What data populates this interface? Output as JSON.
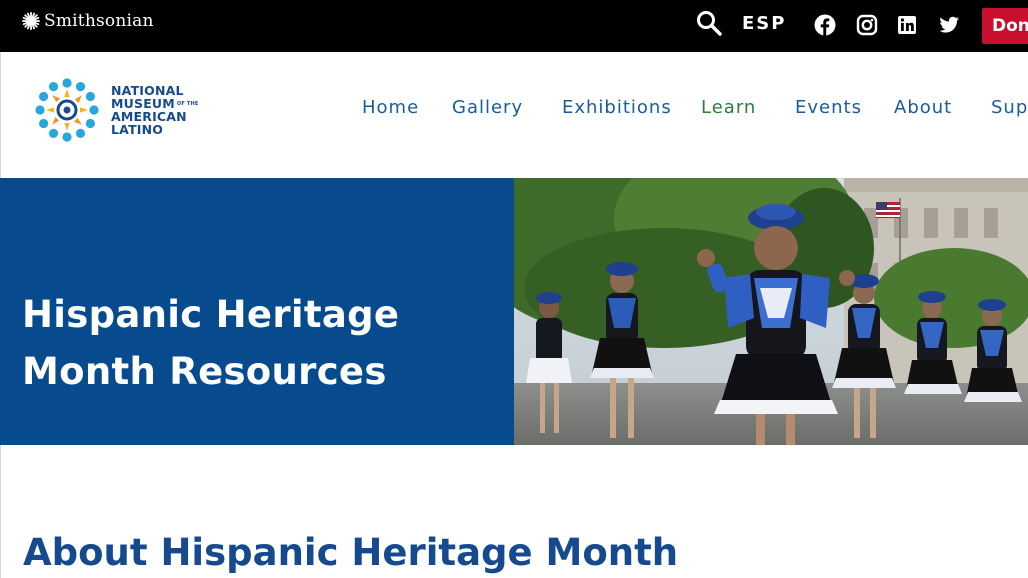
{
  "topbar": {
    "brand_label": "Smithsonian",
    "search_icon": "search-icon",
    "language_label": "ESP",
    "social": [
      {
        "name": "facebook-icon"
      },
      {
        "name": "instagram-icon"
      },
      {
        "name": "linkedin-icon"
      },
      {
        "name": "twitter-icon"
      }
    ],
    "donate_label": "Don"
  },
  "header": {
    "logo_lines": [
      "NATIONAL",
      "MUSEUM",
      "AMERICAN",
      "LATINO"
    ],
    "logo_small": "OF THE",
    "nav": [
      {
        "label": "Home"
      },
      {
        "label": "Gallery"
      },
      {
        "label": "Exhibitions"
      },
      {
        "label": "Learn"
      },
      {
        "label": "Events"
      },
      {
        "label": "About"
      },
      {
        "label": "Sup"
      }
    ]
  },
  "hero": {
    "title_line1": "Hispanic Heritage",
    "title_line2": "Month Resources"
  },
  "content": {
    "heading": "About Hispanic Heritage Month"
  },
  "colors": {
    "topbar_bg": "#000000",
    "brand_blue": "#074a8e",
    "nav_blue": "#1a5c9e",
    "nav_green": "#2e7d3a",
    "donate_red": "#c8102e"
  }
}
